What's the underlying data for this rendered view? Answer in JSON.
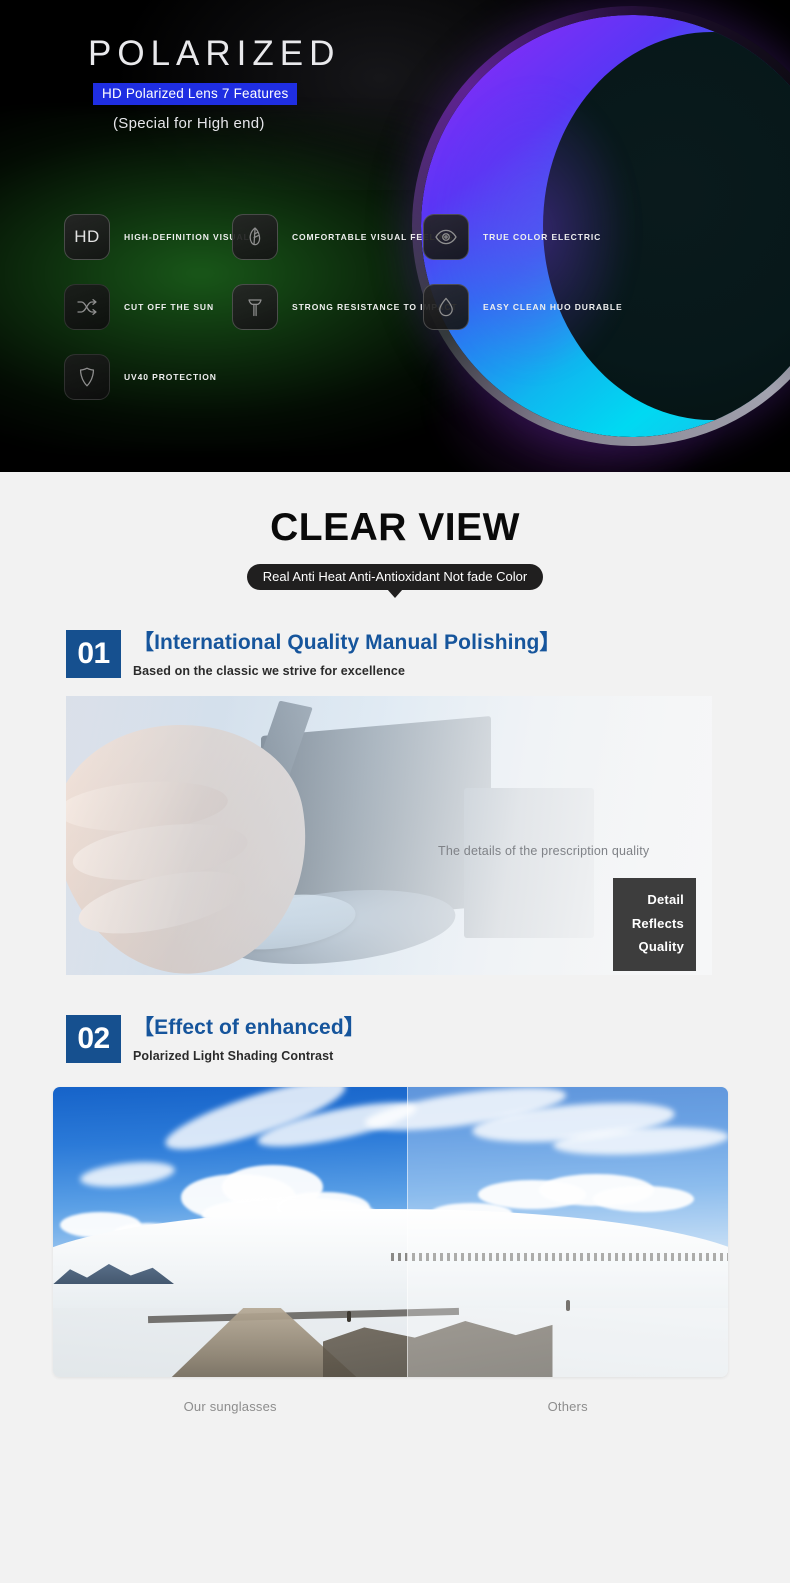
{
  "hero": {
    "title": "POLARIZED",
    "badge": "HD Polarized Lens 7 Features",
    "subtitle": "(Special for High end)",
    "badge_color": "#1f2ee2",
    "features": [
      {
        "icon": "hd-icon",
        "glyph": "HD",
        "label": "HIGH-DEFINITION VISUAL"
      },
      {
        "icon": "leaf-icon",
        "glyph": "leaf",
        "label": "COMFORTABLE VISUAL FEELING"
      },
      {
        "icon": "eye-icon",
        "glyph": "eye",
        "label": "TRUE COLOR ELECTRIC"
      },
      {
        "icon": "shuffle-icon",
        "glyph": "shuffle",
        "label": "CUT OFF THE SUN"
      },
      {
        "icon": "hammer-icon",
        "glyph": "hammer",
        "label": "STRONG RESISTANCE TO IMPACT"
      },
      {
        "icon": "water-drop-icon",
        "glyph": "drop",
        "label": "EASY CLEAN HUO DURABLE"
      },
      {
        "icon": "shield-icon",
        "glyph": "shield",
        "label": "UV40 PROTECTION"
      }
    ]
  },
  "clear_view": {
    "title": "CLEAR VIEW",
    "badge": "Real Anti Heat Anti-Antioxidant Not fade Color"
  },
  "sections": [
    {
      "number": "01",
      "title": "【International Quality Manual Polishing】",
      "subtitle": "Based on the classic we strive for excellence",
      "photo_caption": "The details of the prescription quality",
      "photo_box": [
        "Detail",
        "Reflects",
        "Quality"
      ]
    },
    {
      "number": "02",
      "title": "【Effect of enhanced】",
      "subtitle": "Polarized Light Shading Contrast",
      "caption_left": "Our sunglasses",
      "caption_right": "Others"
    }
  ],
  "colors": {
    "accent_blue": "#16559c",
    "badge_navy": "#16508f",
    "hero_badge_blue": "#1f2ee2",
    "dark_badge": "#201f1f",
    "page_bg": "#f2f2f2"
  }
}
